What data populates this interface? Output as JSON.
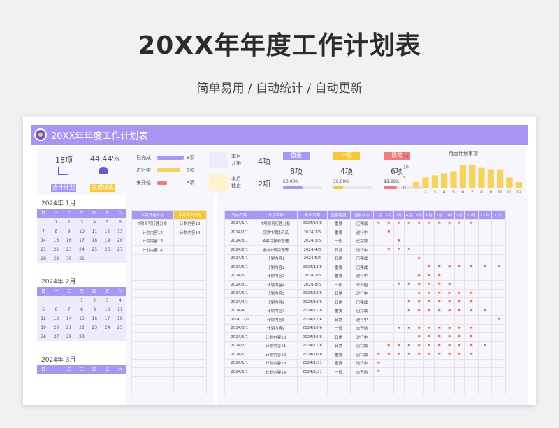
{
  "page": {
    "title": "20XX年年度工作计划表",
    "subtitle": "简单易用 / 自动统计 / 自动更新"
  },
  "sheet": {
    "title": "20XX年年度工作计划表"
  },
  "summary": {
    "total_count": "18项",
    "total_label": "合计计划",
    "rate": "44.44%",
    "rate_label": "完成进度",
    "status": [
      {
        "label": "已完成",
        "count": "8项",
        "value": 8,
        "color": "#a896f2"
      },
      {
        "label": "进行中",
        "count": "7项",
        "value": 7,
        "color": "#f7d35e"
      },
      {
        "label": "未开始",
        "count": "3项",
        "value": 3,
        "color": "#ef7c7c"
      }
    ],
    "month_start_label": "本月\n开始",
    "month_start_count": "4项",
    "month_end_label": "本月\n截止",
    "month_end_count": "2项",
    "priority": [
      {
        "label": "重要",
        "count": "8项",
        "pct": "50.00%",
        "fill": 0.5,
        "color": "#a896f2"
      },
      {
        "label": "一般",
        "count": "4项",
        "pct": "25.00%",
        "fill": 0.25,
        "color": "#f7c833"
      },
      {
        "label": "日常",
        "count": "6项",
        "pct": "33.33%",
        "fill": 0.3333,
        "color": "#ef7c7c"
      }
    ]
  },
  "chart_data": {
    "type": "bar",
    "title": "月度计划事项",
    "categories": [
      "1",
      "2",
      "3",
      "4",
      "5",
      "6",
      "7",
      "8",
      "9",
      "10",
      "11",
      "12"
    ],
    "values": [
      3,
      5,
      6,
      7,
      8,
      11,
      11,
      10,
      9,
      9,
      5,
      3
    ],
    "ylim": [
      0,
      15
    ],
    "yticks": [
      "0",
      "5",
      "10",
      "15"
    ],
    "color": "#f7d35e"
  },
  "calendars": [
    {
      "year": "2024年",
      "month": "1月",
      "days": [
        "",
        "1",
        "2",
        "3",
        "4",
        "5",
        "6",
        "7",
        "8",
        "9",
        "10",
        "11",
        "12",
        "13",
        "14",
        "15",
        "16",
        "17",
        "18",
        "19",
        "20",
        "21",
        "22",
        "23",
        "24",
        "25",
        "26",
        "27",
        "28",
        "29",
        "30",
        "31",
        "",
        "",
        ""
      ]
    },
    {
      "year": "2024年",
      "month": "2月",
      "days": [
        "",
        "",
        "",
        "1",
        "2",
        "3",
        "4",
        "5",
        "6",
        "7",
        "8",
        "9",
        "10",
        "11",
        "12",
        "13",
        "14",
        "15",
        "16",
        "17",
        "18",
        "19",
        "20",
        "21",
        "22",
        "23",
        "24",
        "25",
        "26",
        "27",
        "28",
        "29",
        "",
        ""
      ]
    },
    {
      "year": "2024年",
      "month": "3月",
      "days": []
    }
  ],
  "weekdays": [
    "日",
    "一",
    "二",
    "三",
    "四",
    "五",
    "六"
  ],
  "month_lists": {
    "start_header": "本月开始计划",
    "end_header": "本月截止计划",
    "start": [
      "T项目可行性分析",
      "计划内容12",
      "计划内容13",
      "计划内容14"
    ],
    "end": [
      "计划内容13",
      "计划内容14"
    ]
  },
  "plan_table": {
    "headers": [
      "开始日期",
      "计划名称",
      "截止日期",
      "重要程度",
      "当前状态"
    ],
    "months": [
      "1月",
      "2月",
      "3月",
      "4月",
      "5月",
      "6月",
      "7月",
      "8月",
      "9月",
      "10月",
      "11月",
      "12月"
    ],
    "rows": [
      {
        "start": "2024/1/1",
        "name": "T项目可行性分析",
        "end": "2024/10/6",
        "level": "重要",
        "status": "已完成",
        "flags": [
          1,
          1,
          1,
          1,
          1,
          1,
          1,
          1,
          1,
          1,
          0,
          0
        ]
      },
      {
        "start": "2024/2/1",
        "name": "采购T项目产品",
        "end": "2024/2/6",
        "level": "重要",
        "status": "进行中",
        "flags": [
          0,
          1,
          0,
          0,
          0,
          0,
          0,
          0,
          0,
          0,
          0,
          0
        ]
      },
      {
        "start": "2024/3/1",
        "name": "A项目报表管理",
        "end": "2024/3/6",
        "level": "一般",
        "status": "已完成",
        "flags": [
          0,
          0,
          1,
          0,
          0,
          0,
          0,
          0,
          0,
          0,
          0,
          0
        ]
      },
      {
        "start": "2024/2/1",
        "name": "参加B项目预算",
        "end": "2024/4/6",
        "level": "日常",
        "status": "进行中",
        "flags": [
          0,
          1,
          1,
          1,
          0,
          0,
          0,
          0,
          0,
          0,
          0,
          0
        ]
      },
      {
        "start": "2024/5/1",
        "name": "计划内容1",
        "end": "2024/5/6",
        "level": "日常",
        "status": "已完成",
        "flags": [
          0,
          0,
          0,
          0,
          1,
          0,
          0,
          0,
          0,
          0,
          0,
          0
        ]
      },
      {
        "start": "2024/6/1",
        "name": "计划内容2",
        "end": "2024/12/6",
        "level": "重要",
        "status": "已完成",
        "flags": [
          0,
          0,
          0,
          0,
          0,
          1,
          1,
          1,
          1,
          1,
          1,
          1
        ]
      },
      {
        "start": "2024/5/1",
        "name": "计划内容3",
        "end": "2024/7/6",
        "level": "重要",
        "status": "进行中",
        "flags": [
          0,
          0,
          0,
          0,
          1,
          1,
          1,
          0,
          0,
          0,
          0,
          0
        ]
      },
      {
        "start": "2024/3/1",
        "name": "计划内容4",
        "end": "2024/8/6",
        "level": "一般",
        "status": "未开始",
        "flags": [
          0,
          0,
          1,
          1,
          1,
          1,
          1,
          1,
          0,
          0,
          0,
          0
        ]
      },
      {
        "start": "2024/5/1",
        "name": "计划内容5",
        "end": "2024/10/6",
        "level": "日常",
        "status": "进行中",
        "flags": [
          0,
          0,
          0,
          0,
          1,
          1,
          1,
          1,
          1,
          1,
          0,
          0
        ]
      },
      {
        "start": "2024/4/1",
        "name": "计划内容6",
        "end": "2024/10/6",
        "level": "日常",
        "status": "已完成",
        "flags": [
          0,
          0,
          0,
          1,
          1,
          1,
          1,
          1,
          1,
          1,
          0,
          0
        ]
      },
      {
        "start": "2024/4/1",
        "name": "计划内容7",
        "end": "2024/11/6",
        "level": "重要",
        "status": "已完成",
        "flags": [
          0,
          0,
          0,
          1,
          1,
          1,
          1,
          1,
          1,
          1,
          1,
          0
        ]
      },
      {
        "start": "2024/12/1",
        "name": "计划内容8",
        "end": "2024/12/6",
        "level": "日常",
        "status": "进行中",
        "flags": [
          0,
          0,
          0,
          0,
          0,
          0,
          0,
          0,
          0,
          0,
          0,
          1
        ]
      },
      {
        "start": "2024/3/1",
        "name": "计划内容9",
        "end": "2024/10/6",
        "level": "一般",
        "status": "未开始",
        "flags": [
          0,
          0,
          1,
          1,
          1,
          1,
          1,
          1,
          1,
          1,
          0,
          0
        ]
      },
      {
        "start": "2024/5/1",
        "name": "计划内容10",
        "end": "2024/10/6",
        "level": "日常",
        "status": "进行中",
        "flags": [
          0,
          0,
          0,
          0,
          1,
          1,
          1,
          1,
          1,
          1,
          0,
          0
        ]
      },
      {
        "start": "2024/2/1",
        "name": "计划内容11",
        "end": "2024/11/6",
        "level": "日常",
        "status": "已完成",
        "flags": [
          0,
          1,
          1,
          1,
          1,
          1,
          1,
          1,
          1,
          1,
          1,
          0
        ]
      },
      {
        "start": "2024/1/1",
        "name": "计划内容12",
        "end": "2024/10/6",
        "level": "重要",
        "status": "已完成",
        "flags": [
          1,
          1,
          1,
          1,
          1,
          1,
          1,
          1,
          1,
          1,
          0,
          0
        ]
      },
      {
        "start": "2024/1/1",
        "name": "计划内容13",
        "end": "2024/1/31",
        "level": "重要",
        "status": "进行中",
        "flags": [
          1,
          0,
          0,
          0,
          0,
          0,
          0,
          0,
          0,
          0,
          0,
          0
        ]
      },
      {
        "start": "2024/1/1",
        "name": "计划内容14",
        "end": "2024/1/31",
        "level": "一般",
        "status": "未开始",
        "flags": [
          1,
          0,
          0,
          0,
          0,
          0,
          0,
          0,
          0,
          0,
          0,
          0
        ]
      }
    ]
  }
}
